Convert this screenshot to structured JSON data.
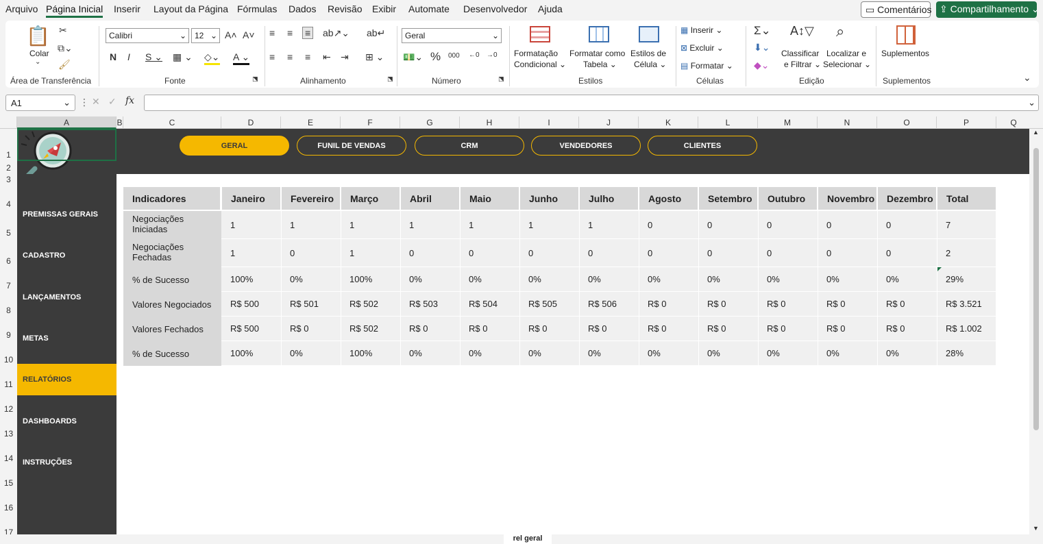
{
  "menu": [
    "Arquivo",
    "Página Inicial",
    "Inserir",
    "Layout da Página",
    "Fórmulas",
    "Dados",
    "Revisão",
    "Exibir",
    "Automate",
    "Desenvolvedor",
    "Ajuda"
  ],
  "comments_label": "Comentários",
  "share_label": "Compartilhamento",
  "ribbon": {
    "paste_label": "Colar",
    "font_name": "Calibri",
    "font_size": "12",
    "number_format": "Geral",
    "cond_format_1": "Formatação",
    "cond_format_2": "Condicional",
    "format_table_1": "Formatar como",
    "format_table_2": "Tabela",
    "cell_styles_1": "Estilos de",
    "cell_styles_2": "Célula",
    "insert_label": "Inserir",
    "delete_label": "Excluir",
    "format_label": "Formatar",
    "sort_1": "Classificar",
    "sort_2": "e Filtrar",
    "find_1": "Localizar e",
    "find_2": "Selecionar",
    "addins_label": "Suplementos",
    "groups": {
      "clipboard": "Área de Transferência",
      "font": "Fonte",
      "alignment": "Alinhamento",
      "number": "Número",
      "styles": "Estilos",
      "cells": "Células",
      "editing": "Edição",
      "addins": "Suplementos"
    }
  },
  "name_box": "A1",
  "columns": [
    "A",
    "B",
    "C",
    "D",
    "E",
    "F",
    "G",
    "H",
    "I",
    "J",
    "K",
    "L",
    "M",
    "N",
    "O",
    "P",
    "Q"
  ],
  "rows": [
    "1",
    "2",
    "3",
    "4",
    "5",
    "6",
    "7",
    "8",
    "9",
    "10",
    "11",
    "12",
    "13",
    "14",
    "15",
    "16",
    "17"
  ],
  "topnav": [
    "GERAL",
    "FUNIL DE VENDAS",
    "CRM",
    "VENDEDORES",
    "CLIENTES"
  ],
  "sidebar": [
    "PREMISSAS GERAIS",
    "CADASTRO",
    "LANÇAMENTOS",
    "METAS",
    "RELATÓRIOS",
    "DASHBOARDS",
    "INSTRUÇÕES"
  ],
  "table": {
    "headers": [
      "Indicadores",
      "Janeiro",
      "Fevereiro",
      "Março",
      "Abril",
      "Maio",
      "Junho",
      "Julho",
      "Agosto",
      "Setembro",
      "Outubro",
      "Novembro",
      "Dezembro",
      "Total"
    ],
    "rows": [
      {
        "label1": "Negociações",
        "label2": "Iniciadas",
        "values": [
          "1",
          "1",
          "1",
          "1",
          "1",
          "1",
          "1",
          "0",
          "0",
          "0",
          "0",
          "0",
          "7"
        ]
      },
      {
        "label1": "Negociações",
        "label2": "Fechadas",
        "values": [
          "1",
          "0",
          "1",
          "0",
          "0",
          "0",
          "0",
          "0",
          "0",
          "0",
          "0",
          "0",
          "2"
        ]
      },
      {
        "label1": "% de Sucesso",
        "label2": "",
        "values": [
          "100%",
          "0%",
          "100%",
          "0%",
          "0%",
          "0%",
          "0%",
          "0%",
          "0%",
          "0%",
          "0%",
          "0%",
          "29%"
        ]
      },
      {
        "label1": "Valores Negociados",
        "label2": "",
        "values": [
          "R$ 500",
          "R$ 501",
          "R$ 502",
          "R$ 503",
          "R$ 504",
          "R$ 505",
          "R$ 506",
          "R$ 0",
          "R$ 0",
          "R$ 0",
          "R$ 0",
          "R$ 0",
          "R$ 3.521"
        ]
      },
      {
        "label1": "Valores Fechados",
        "label2": "",
        "values": [
          "R$ 500",
          "R$ 0",
          "R$ 502",
          "R$ 0",
          "R$ 0",
          "R$ 0",
          "R$ 0",
          "R$ 0",
          "R$ 0",
          "R$ 0",
          "R$ 0",
          "R$ 0",
          "R$ 1.002"
        ]
      },
      {
        "label1": "% de Sucesso",
        "label2": "",
        "values": [
          "100%",
          "0%",
          "100%",
          "0%",
          "0%",
          "0%",
          "0%",
          "0%",
          "0%",
          "0%",
          "0%",
          "0%",
          "28%"
        ]
      }
    ]
  },
  "active_sheet_tab": "rel geral",
  "colors": {
    "accent": "#f5b800",
    "dark": "#3b3b3b",
    "excel_green": "#1e7145"
  }
}
